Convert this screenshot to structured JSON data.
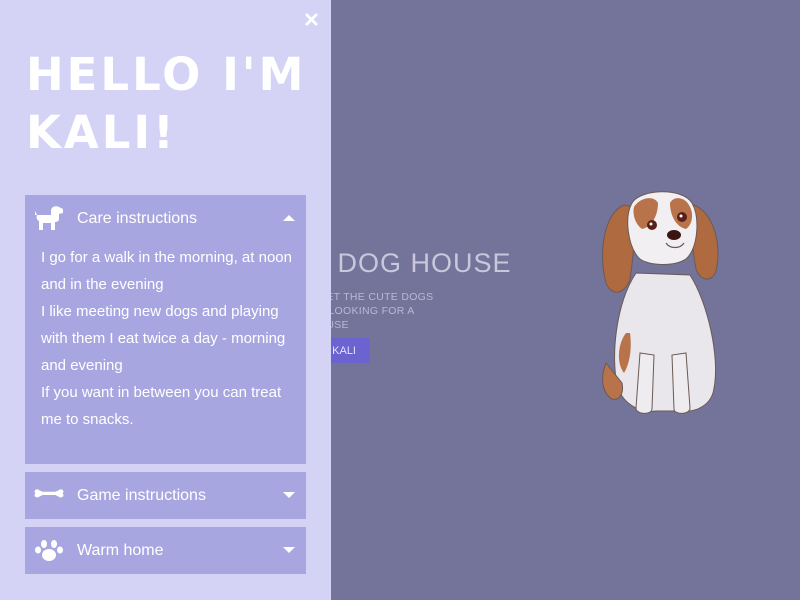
{
  "background": {
    "title": "E DOG HOUSE",
    "subtitle_lines": [
      "MEET THE CUTE DOGS",
      "RE LOOKING FOR A",
      "HOUSE"
    ],
    "button_label": "KALI"
  },
  "panel": {
    "close_icon": "close-icon",
    "title": "HELLO I'M KALI!",
    "accordion": [
      {
        "icon": "dog-icon",
        "label": "Care instructions",
        "expanded": true,
        "paragraphs": [
          "I go for a walk in the morning, at noon and in the evening",
          "I like meeting new dogs and playing with them I eat twice a day - morning and evening",
          "If you want in between you can treat me to snacks."
        ]
      },
      {
        "icon": "bone-icon",
        "label": "Game instructions",
        "expanded": false
      },
      {
        "icon": "paw-icon",
        "label": "Warm home",
        "expanded": false
      }
    ]
  },
  "colors": {
    "panel_bg": "#d4d3f6",
    "accordion_bg": "#a8a6e0",
    "overlay_bg": "#747399",
    "button_bg": "#6a63d0"
  }
}
